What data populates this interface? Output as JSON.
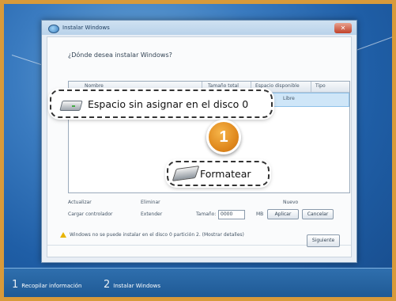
{
  "window": {
    "title": "Instalar Windows",
    "close_glyph": "✕",
    "question": "¿Dónde desea instalar Windows?"
  },
  "list": {
    "columns": [
      "Nombre",
      "Tamaño total",
      "Espacio disponible",
      "Tipo"
    ],
    "selected_row_extra": "Libre"
  },
  "callouts": {
    "unallocated_label": "Espacio sin asignar en el disco 0",
    "format_label": "Formatear"
  },
  "badge": {
    "number": "1"
  },
  "options": {
    "refresh": "Actualizar",
    "delete": "Eliminar",
    "new": "Nuevo",
    "load_driver": "Cargar controlador",
    "extend": "Extender",
    "size_label": "Tamaño:",
    "size_value": "0000",
    "size_unit": "MB",
    "apply": "Aplicar",
    "cancel": "Cancelar"
  },
  "warning": {
    "text": "Windows no se puede instalar en el disco 0 partición 2. (Mostrar detalles)"
  },
  "buttons": {
    "next": "Siguiente"
  },
  "steps": [
    {
      "number": "1",
      "label": "Recopilar información"
    },
    {
      "number": "2",
      "label": "Instalar Windows"
    }
  ],
  "colors": {
    "accent_orange": "#e0891d",
    "desktop_blue": "#2b6fb5",
    "frame_orange": "#d89a3a"
  },
  "icons": [
    "windows-setup-icon",
    "hard-disk-icon",
    "eraser-icon",
    "warning-icon"
  ]
}
